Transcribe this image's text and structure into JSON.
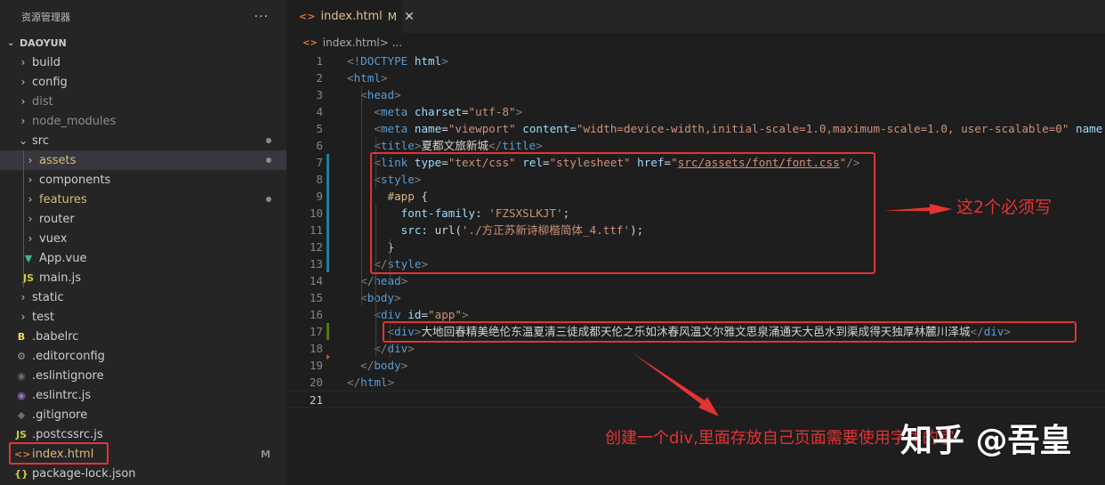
{
  "sidebar": {
    "title": "资源管理器",
    "more": "···",
    "project": "DAOYUN",
    "items": [
      {
        "label": "build",
        "type": "folder",
        "depth": 0
      },
      {
        "label": "config",
        "type": "folder",
        "depth": 0
      },
      {
        "label": "dist",
        "type": "folder",
        "depth": 0,
        "dim": true
      },
      {
        "label": "node_modules",
        "type": "folder",
        "depth": 0,
        "dim": true
      },
      {
        "label": "src",
        "type": "folder-open",
        "depth": 0,
        "dot": true
      },
      {
        "label": "assets",
        "type": "folder",
        "depth": 1,
        "dot": true,
        "selected": true,
        "color": "orange"
      },
      {
        "label": "components",
        "type": "folder",
        "depth": 1
      },
      {
        "label": "features",
        "type": "folder",
        "depth": 1,
        "dot": true,
        "color": "orange"
      },
      {
        "label": "router",
        "type": "folder",
        "depth": 1
      },
      {
        "label": "vuex",
        "type": "folder",
        "depth": 1
      },
      {
        "label": "App.vue",
        "type": "vue",
        "depth": 1
      },
      {
        "label": "main.js",
        "type": "js",
        "depth": 1
      },
      {
        "label": "static",
        "type": "folder",
        "depth": 0
      },
      {
        "label": "test",
        "type": "folder",
        "depth": 0
      },
      {
        "label": ".babelrc",
        "type": "babel",
        "depth": 0
      },
      {
        "label": ".editorconfig",
        "type": "gear",
        "depth": 0
      },
      {
        "label": ".eslintignore",
        "type": "eslint-ignore",
        "depth": 0
      },
      {
        "label": ".eslintrc.js",
        "type": "eslint",
        "depth": 0
      },
      {
        "label": ".gitignore",
        "type": "git",
        "depth": 0
      },
      {
        "label": ".postcssrc.js",
        "type": "js",
        "depth": 0
      },
      {
        "label": "index.html",
        "type": "html",
        "depth": 0,
        "badge": "M",
        "color": "orange"
      },
      {
        "label": "package-lock.json",
        "type": "json",
        "depth": 0
      }
    ]
  },
  "editor": {
    "tab": {
      "icon": "<>",
      "label": "index.html",
      "state": "M",
      "close": "✕"
    },
    "breadcrumb": {
      "icon": "<>",
      "file": "index.html",
      "rest": " > ..."
    },
    "lines": [
      [
        [
          "p",
          "<!"
        ],
        [
          "t",
          "DOCTYPE"
        ],
        [
          "d",
          " "
        ],
        [
          "a",
          "html"
        ],
        [
          "p",
          ">"
        ]
      ],
      [
        [
          "p",
          "<"
        ],
        [
          "t",
          "html"
        ],
        [
          "p",
          ">"
        ]
      ],
      [
        [
          "d",
          "  "
        ],
        [
          "p",
          "<"
        ],
        [
          "t",
          "head"
        ],
        [
          "p",
          ">"
        ]
      ],
      [
        [
          "d",
          "    "
        ],
        [
          "p",
          "<"
        ],
        [
          "t",
          "meta"
        ],
        [
          "d",
          " "
        ],
        [
          "a",
          "charset"
        ],
        [
          "d",
          "="
        ],
        [
          "s",
          "\"utf-8\""
        ],
        [
          "p",
          ">"
        ]
      ],
      [
        [
          "d",
          "    "
        ],
        [
          "p",
          "<"
        ],
        [
          "t",
          "meta"
        ],
        [
          "d",
          " "
        ],
        [
          "a",
          "name"
        ],
        [
          "d",
          "="
        ],
        [
          "s",
          "\"viewport\""
        ],
        [
          "d",
          " "
        ],
        [
          "a",
          "content"
        ],
        [
          "d",
          "="
        ],
        [
          "s",
          "\"width=device-width,initial-scale=1.0,maximum-scale=1.0, user-scalable=0\""
        ],
        [
          "d",
          " "
        ],
        [
          "a",
          "name"
        ]
      ],
      [
        [
          "d",
          "    "
        ],
        [
          "p",
          "<"
        ],
        [
          "t",
          "title"
        ],
        [
          "p",
          ">"
        ],
        [
          "d",
          "夏都文旅新城"
        ],
        [
          "p",
          "</"
        ],
        [
          "t",
          "title"
        ],
        [
          "p",
          ">"
        ]
      ],
      [
        [
          "d",
          "    "
        ],
        [
          "p",
          "<"
        ],
        [
          "t",
          "link"
        ],
        [
          "d",
          " "
        ],
        [
          "a",
          "type"
        ],
        [
          "d",
          "="
        ],
        [
          "s",
          "\"text/css\""
        ],
        [
          "d",
          " "
        ],
        [
          "a",
          "rel"
        ],
        [
          "d",
          "="
        ],
        [
          "s",
          "\"stylesheet\""
        ],
        [
          "d",
          " "
        ],
        [
          "a",
          "href"
        ],
        [
          "d",
          "="
        ],
        [
          "s",
          "\""
        ],
        [
          "su",
          "src/assets/font/font.css"
        ],
        [
          "s",
          "\""
        ],
        [
          "p",
          "/>"
        ]
      ],
      [
        [
          "d",
          "    "
        ],
        [
          "p",
          "<"
        ],
        [
          "t",
          "style"
        ],
        [
          "p",
          ">"
        ]
      ],
      [
        [
          "d",
          "      "
        ],
        [
          "sel",
          "#app"
        ],
        [
          "d",
          " {"
        ]
      ],
      [
        [
          "d",
          "        "
        ],
        [
          "a",
          "font-family"
        ],
        [
          "d",
          ": "
        ],
        [
          "s",
          "'FZSXSLKJT'"
        ],
        [
          "d",
          ";"
        ]
      ],
      [
        [
          "d",
          "        "
        ],
        [
          "a",
          "src"
        ],
        [
          "d",
          ": url("
        ],
        [
          "s",
          "'./方正苏新诗柳楷简体_4.ttf'"
        ],
        [
          "d",
          ");"
        ]
      ],
      [
        [
          "d",
          "      }"
        ]
      ],
      [
        [
          "d",
          "    "
        ],
        [
          "p",
          "</"
        ],
        [
          "t",
          "style"
        ],
        [
          "p",
          ">"
        ]
      ],
      [
        [
          "d",
          "  "
        ],
        [
          "p",
          "</"
        ],
        [
          "t",
          "head"
        ],
        [
          "p",
          ">"
        ]
      ],
      [
        [
          "d",
          "  "
        ],
        [
          "p",
          "<"
        ],
        [
          "t",
          "body"
        ],
        [
          "p",
          ">"
        ]
      ],
      [
        [
          "d",
          "    "
        ],
        [
          "p",
          "<"
        ],
        [
          "t",
          "div"
        ],
        [
          "d",
          " "
        ],
        [
          "a",
          "id"
        ],
        [
          "d",
          "="
        ],
        [
          "s",
          "\"app\""
        ],
        [
          "p",
          ">"
        ]
      ],
      [
        [
          "d",
          "      "
        ],
        [
          "p",
          "<"
        ],
        [
          "t",
          "div"
        ],
        [
          "p",
          ">"
        ],
        [
          "d",
          "大地回春精美绝伦东温夏清三徒成都天伦之乐如沐春风温文尔雅文思泉涌通天大邑水到渠成得天独厚林麓川泽城"
        ],
        [
          "p",
          "</"
        ],
        [
          "t",
          "div"
        ],
        [
          "p",
          ">"
        ]
      ],
      [
        [
          "d",
          "    "
        ],
        [
          "p",
          "</"
        ],
        [
          "t",
          "div"
        ],
        [
          "p",
          ">"
        ]
      ],
      [
        [
          "d",
          "  "
        ],
        [
          "p",
          "</"
        ],
        [
          "t",
          "body"
        ],
        [
          "p",
          ">"
        ]
      ],
      [
        [
          "p",
          "</"
        ],
        [
          "t",
          "html"
        ],
        [
          "p",
          ">"
        ]
      ],
      []
    ]
  },
  "annotations": {
    "note1": "这2个必须写",
    "note2": "创建一个div,里面存放自己页面需要使用字体的字"
  },
  "watermark": "知乎 @吾皇",
  "colors": {
    "annotation": "#e53333",
    "tag": "#569cd6",
    "attribute": "#9cdcfe",
    "string": "#ce9178",
    "modified": "#e2c08d"
  }
}
